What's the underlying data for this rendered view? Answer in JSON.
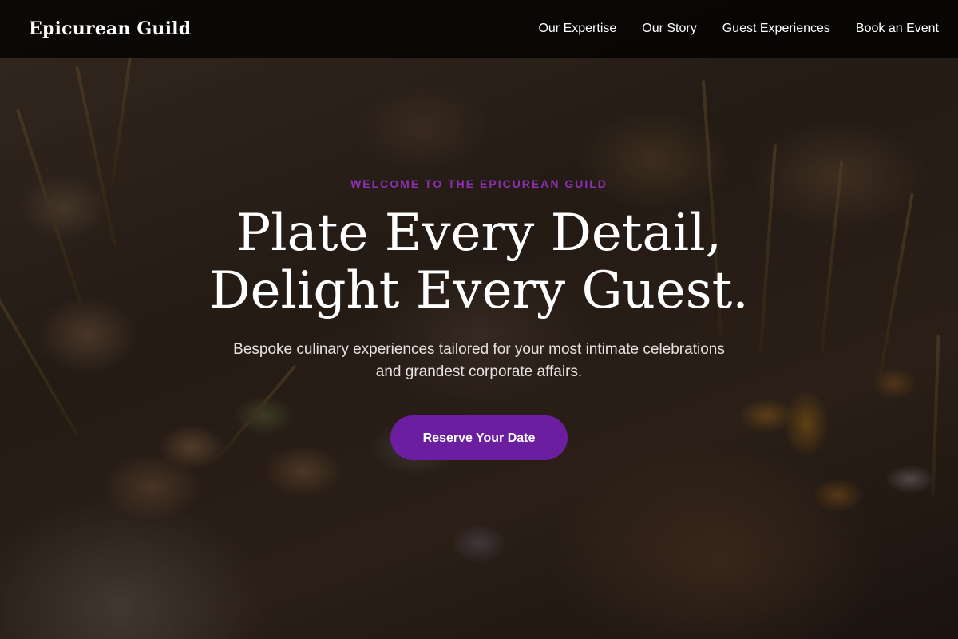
{
  "header": {
    "brand": "Epicurean Guild",
    "nav": [
      {
        "label": "Our Expertise"
      },
      {
        "label": "Our Story"
      },
      {
        "label": "Guest Experiences"
      },
      {
        "label": "Book an Event"
      }
    ]
  },
  "hero": {
    "eyebrow": "WELCOME TO THE EPICUREAN GUILD",
    "headline_line1": "Plate Every Detail,",
    "headline_line2": "Delight Every Guest.",
    "subtitle": "Bespoke culinary experiences tailored for your most intimate celebrations and grandest corporate affairs.",
    "cta_label": "Reserve Your Date",
    "background": "catering-canapes-photo"
  },
  "colors": {
    "accent": "#6b1fa0",
    "eyebrow": "#8e2fb3",
    "nav_background": "#000000",
    "text": "#ffffff"
  }
}
